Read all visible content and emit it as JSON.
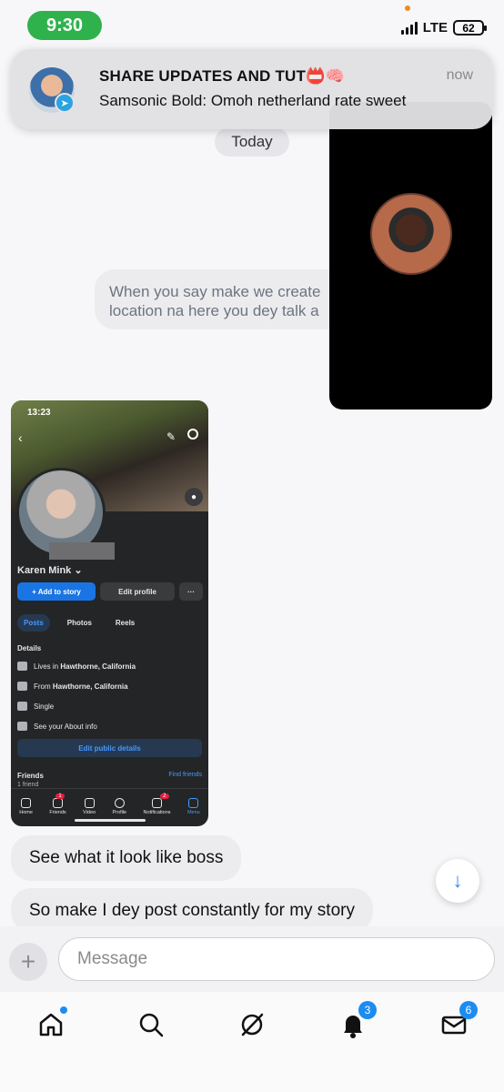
{
  "status_bar": {
    "time": "9:30",
    "network": "LTE",
    "battery": "62"
  },
  "notification": {
    "title": "SHARE UPDATES AND TUT📛🧠",
    "body": "Samsonic Bold: Omoh netherland rate sweet",
    "time": "now"
  },
  "chat": {
    "day_label": "Today",
    "clipped_message": {
      "line1": "When you say make we create",
      "line2": "location na here you dey talk a"
    },
    "messages": [
      "See what it look like boss",
      "So make I dey post constantly for my story"
    ]
  },
  "embedded_screenshot": {
    "time": "13:23",
    "profile_name": "Karen Mink",
    "add_story": "+ Add to story",
    "edit_profile": "Edit profile",
    "more": "···",
    "tabs": [
      "Posts",
      "Photos",
      "Reels"
    ],
    "details_heading": "Details",
    "details": [
      {
        "prefix": "Lives in ",
        "value": "Hawthorne, California"
      },
      {
        "prefix": "From ",
        "value": "Hawthorne, California"
      },
      {
        "prefix": "",
        "value": "Single"
      },
      {
        "prefix": "",
        "value": "See your About info"
      }
    ],
    "edit_public": "Edit public details",
    "friends_heading": "Friends",
    "friends_count": "1 friend",
    "find_friends": "Find friends",
    "nav": [
      {
        "label": "Home",
        "badge": ""
      },
      {
        "label": "Friends",
        "badge": "1"
      },
      {
        "label": "Video",
        "badge": ""
      },
      {
        "label": "Profile",
        "badge": ""
      },
      {
        "label": "Notifications",
        "badge": "2"
      },
      {
        "label": "Menu",
        "badge": ""
      }
    ]
  },
  "compose": {
    "placeholder": "Message"
  },
  "bottom_nav": {
    "notifications_badge": "3",
    "messages_badge": "6"
  },
  "colors": {
    "accent": "#1d8cf0",
    "status_green": "#2fb24c"
  }
}
